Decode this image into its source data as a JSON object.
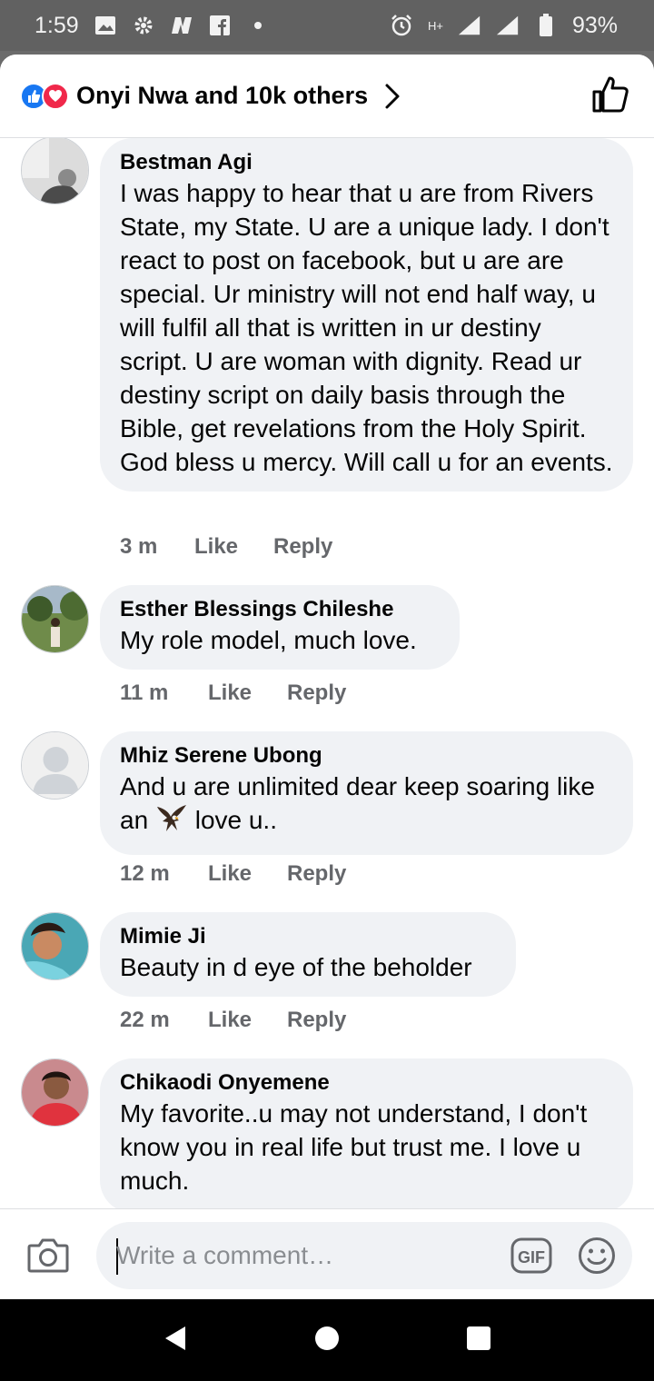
{
  "status_bar": {
    "time": "1:59",
    "left_icons": [
      "image-icon",
      "gear-icon",
      "n-icon",
      "facebook-icon",
      "dot-icon"
    ],
    "network": "H+",
    "battery": "93%"
  },
  "header": {
    "reactors": "Onyi Nwa and 10k others"
  },
  "comments": [
    {
      "name": "Bestman Agi",
      "text": "I was happy to hear that u are from Rivers State, my State. U are a unique lady. I don't react to post on facebook, but u are are special. Ur ministry will not end half way, u will fulfil all that is written in ur destiny script. U are woman with dignity. Read ur destiny script on daily basis through the Bible, get revelations from the Holy Spirit. God bless u mercy. Will call u for an events.",
      "time": "3 m",
      "like": "Like",
      "reply": "Reply"
    },
    {
      "name": "Esther Blessings Chileshe",
      "text": "My role model, much love.",
      "time": "11 m",
      "like": "Like",
      "reply": "Reply"
    },
    {
      "name": "Mhiz Serene Ubong",
      "text_before": "And u are unlimited dear keep soaring like an",
      "text_after": "love u..",
      "time": "12 m",
      "like": "Like",
      "reply": "Reply"
    },
    {
      "name": "Mimie Ji",
      "text": "Beauty in d eye of the beholder",
      "time": "22 m",
      "like": "Like",
      "reply": "Reply"
    },
    {
      "name": "Chikaodi Onyemene",
      "text": "My favorite..u may not understand, I don't know you in real life but trust me. I love u much."
    }
  ],
  "composer": {
    "placeholder": "Write a comment…",
    "gif_label": "GIF"
  },
  "colors": {
    "like_blue": "#1877f2",
    "love_red": "#f0284a",
    "bubble_bg": "#f0f2f5",
    "secondary_text": "#65676b"
  }
}
